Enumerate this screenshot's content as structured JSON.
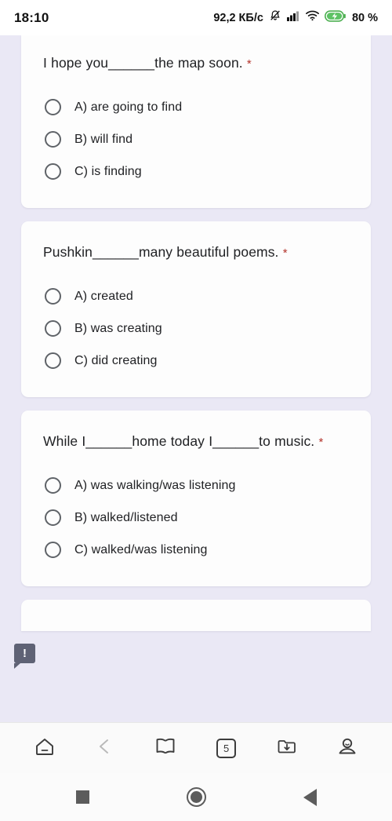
{
  "status_bar": {
    "time": "18:10",
    "network_speed": "92,2 КБ/с",
    "battery_percent": "80 %",
    "icons": [
      "bell-muted-icon",
      "signal-bars-icon",
      "wifi-icon",
      "battery-charging-icon"
    ],
    "battery_color": "#4caf50"
  },
  "theme": {
    "page_background": "#eae8f5",
    "card_background": "#fdfdfd",
    "text_color": "#202124",
    "required_marker_color": "#b3332b",
    "radio_border_color": "#5f6368"
  },
  "questions": [
    {
      "text": "I hope you______the map soon.",
      "required_marker": "*",
      "options": [
        "A) are going to find",
        "B) will find",
        "C) is finding"
      ]
    },
    {
      "text": "Pushkin______many beautiful poems.",
      "required_marker": "*",
      "options": [
        "A) created",
        "B) was creating",
        "C) did creating"
      ]
    },
    {
      "text": "While I______home today I______to music.",
      "required_marker": "*",
      "options": [
        "A) was walking/was listening",
        "B) walked/listened",
        "C) walked/was listening"
      ]
    }
  ],
  "warning_badge": {
    "label": "!"
  },
  "browser_toolbar": {
    "items": [
      {
        "name": "home-icon",
        "label": "Home"
      },
      {
        "name": "back-chevron-icon",
        "label": "Back"
      },
      {
        "name": "bookmarks-book-icon",
        "label": "Bookmarks"
      },
      {
        "name": "tab-counter-icon",
        "label": "5"
      },
      {
        "name": "downloads-folder-icon",
        "label": "Downloads"
      },
      {
        "name": "profile-account-icon",
        "label": "Profile"
      }
    ],
    "tab_count": "5"
  },
  "system_nav": {
    "items": [
      {
        "name": "recents-square-icon",
        "label": "Recents"
      },
      {
        "name": "home-circle-icon",
        "label": "Home"
      },
      {
        "name": "back-triangle-icon",
        "label": "Back"
      }
    ]
  }
}
